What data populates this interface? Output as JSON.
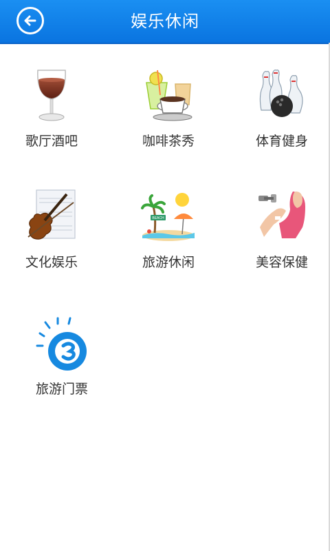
{
  "header": {
    "title": "娱乐休闲",
    "back_icon": "back-arrow-circle-icon"
  },
  "categories": [
    {
      "label": "歌厅酒吧",
      "icon": "wine-glass-icon"
    },
    {
      "label": "咖啡茶秀",
      "icon": "coffee-drinks-icon"
    },
    {
      "label": "体育健身",
      "icon": "bowling-icon"
    },
    {
      "label": "文化娱乐",
      "icon": "violin-icon"
    },
    {
      "label": "旅游休闲",
      "icon": "beach-icon"
    },
    {
      "label": "美容保健",
      "icon": "fitness-woman-icon"
    },
    {
      "label": "旅游门票",
      "icon": "ticket-logo-icon"
    }
  ],
  "beach_sign": "BEACH",
  "colors": {
    "header": "#0a74e0",
    "text": "#333333"
  }
}
